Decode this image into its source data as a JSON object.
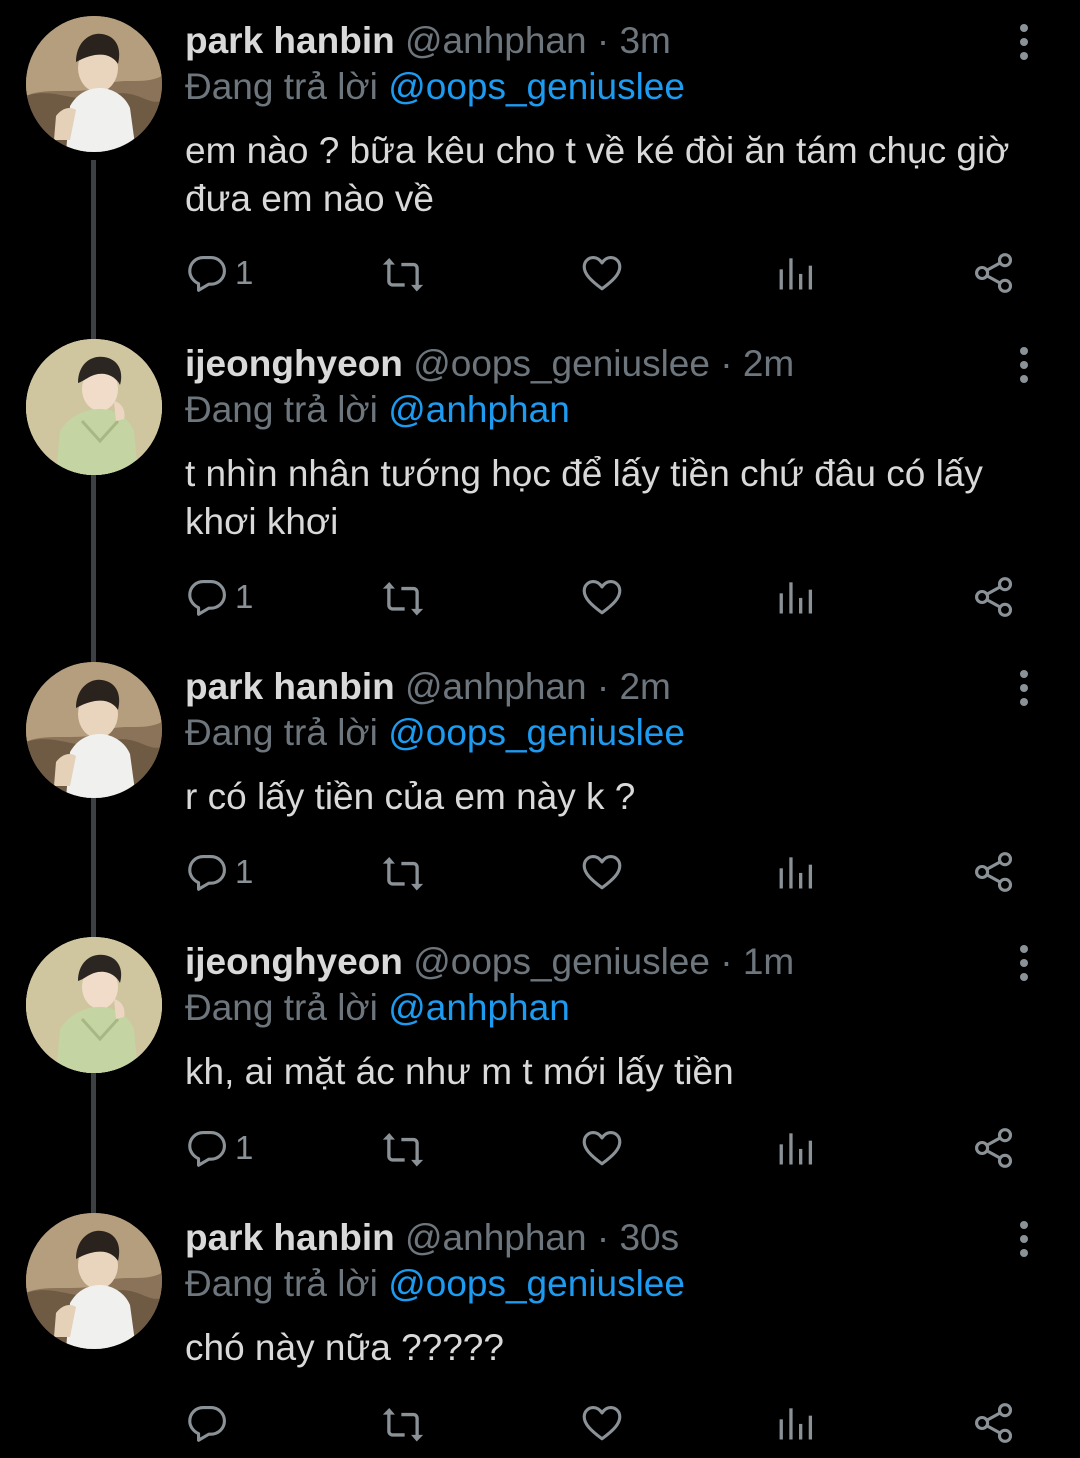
{
  "colors": {
    "background": "#000000",
    "text_primary": "#d9d9d9",
    "text_secondary": "#6e767d",
    "mention": "#1d9bf0",
    "thread_line": "#3d4043",
    "icon": "#8b9297"
  },
  "icons": {
    "reply": "speech-bubble-icon",
    "retweet": "retweet-arrows-icon",
    "like": "heart-outline-icon",
    "stats": "bar-chart-icon",
    "share": "share-nodes-icon",
    "more": "vertical-ellipsis-icon"
  },
  "tweets": [
    {
      "name": "park hanbin",
      "meta": "@anhphan · 3m",
      "reply_prefix": "Đang trả lời",
      "reply_to": "@oops_geniuslee",
      "text": "em nào ? bữa kêu cho t về ké đòi ăn tám chục giờ đưa em nào về",
      "reply_count": "1"
    },
    {
      "name": "ijeonghyeon",
      "meta": "@oops_geniuslee · 2m",
      "reply_prefix": "Đang trả lời",
      "reply_to": "@anhphan",
      "text": "t nhìn nhân tướng học để lấy tiền chứ đâu có lấy khơi khơi",
      "reply_count": "1"
    },
    {
      "name": "park hanbin",
      "meta": "@anhphan · 2m",
      "reply_prefix": "Đang trả lời",
      "reply_to": "@oops_geniuslee",
      "text": "r có lấy tiền của em này k ?",
      "reply_count": "1"
    },
    {
      "name": "ijeonghyeon",
      "meta": "@oops_geniuslee · 1m",
      "reply_prefix": "Đang trả lời",
      "reply_to": "@anhphan",
      "text": "kh, ai mặt ác như m t mới lấy tiền",
      "reply_count": "1"
    },
    {
      "name": "park hanbin",
      "meta": "@anhphan · 30s",
      "reply_prefix": "Đang trả lời",
      "reply_to": "@oops_geniuslee",
      "text": "chó này nữa ?????",
      "reply_count": ""
    }
  ]
}
